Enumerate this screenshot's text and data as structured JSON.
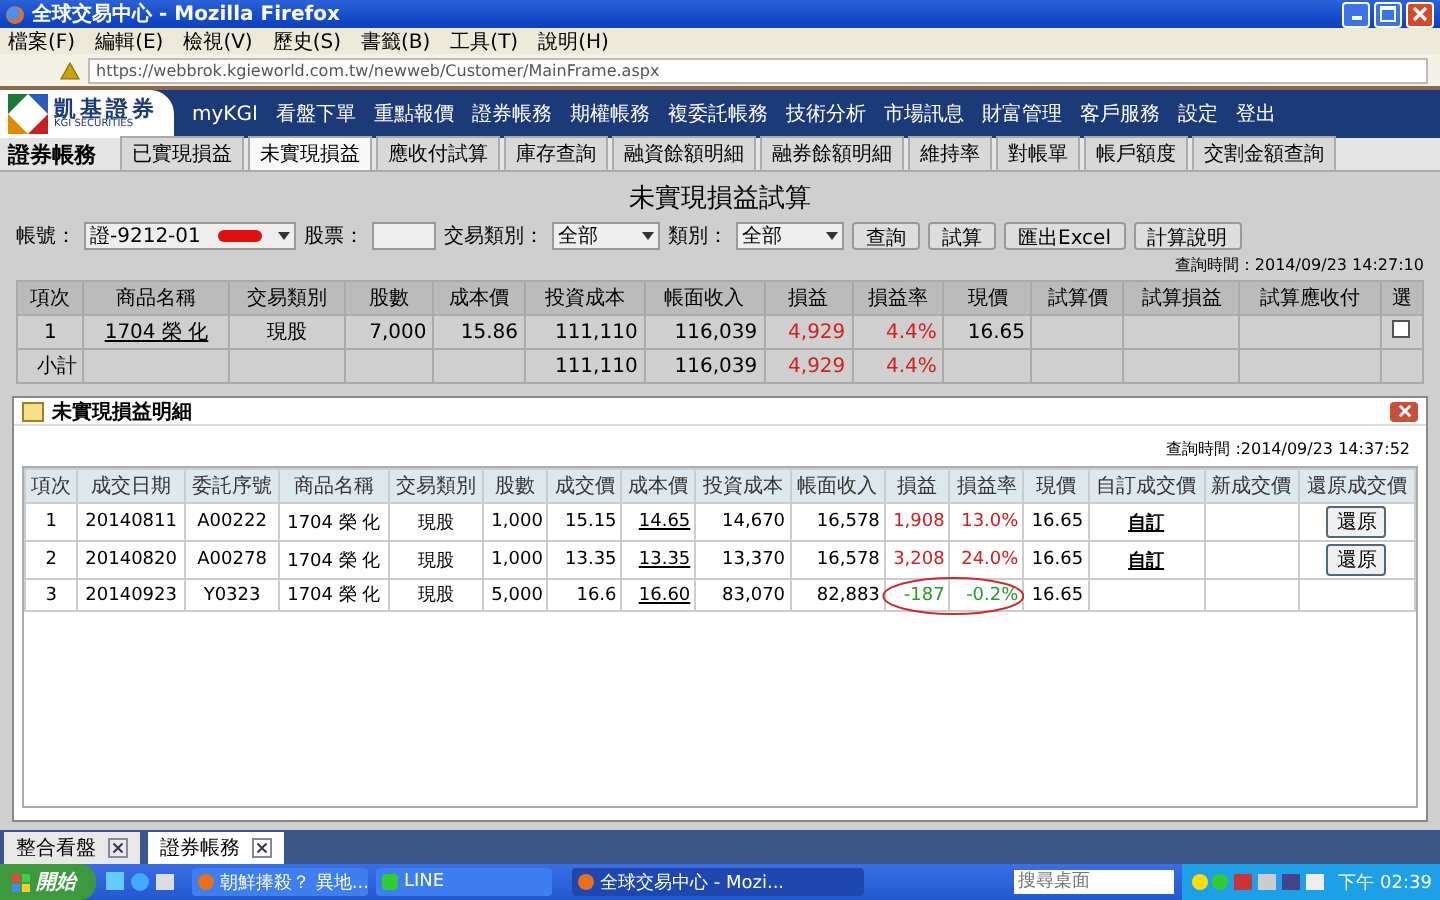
{
  "window": {
    "title": "全球交易中心 - Mozilla Firefox"
  },
  "menu": [
    "檔案(F)",
    "編輯(E)",
    "檢視(V)",
    "歷史(S)",
    "書籤(B)",
    "工具(T)",
    "說明(H)"
  ],
  "address_bar": {
    "url": "https://webbrok.kgieworld.com.tw/newweb/Customer/MainFrame.aspx"
  },
  "brand": {
    "name": "凱基證券",
    "sub": "KGI SECURITIES"
  },
  "nav": [
    "myKGI",
    "看盤下單",
    "重點報價",
    "證券帳務",
    "期權帳務",
    "複委託帳務",
    "技術分析",
    "市場訊息",
    "財富管理",
    "客戶服務",
    "設定",
    "登出"
  ],
  "section_title": "證券帳務",
  "tabs": [
    {
      "label": "已實現損益",
      "selected": false
    },
    {
      "label": "未實現損益",
      "selected": true
    },
    {
      "label": "應收付試算",
      "selected": false
    },
    {
      "label": "庫存查詢",
      "selected": false
    },
    {
      "label": "融資餘額明細",
      "selected": false
    },
    {
      "label": "融券餘額明細",
      "selected": false
    },
    {
      "label": "維持率",
      "selected": false
    },
    {
      "label": "對帳單",
      "selected": false
    },
    {
      "label": "帳戶額度",
      "selected": false
    },
    {
      "label": "交割金額查詢",
      "selected": false
    }
  ],
  "page_title": "未實現損益試算",
  "filters": {
    "account_label": "帳號：",
    "account_value": "證-9212-01",
    "stock_label": "股票：",
    "trade_type_label": "交易類別：",
    "trade_type_value": "全部",
    "category_label": "類別：",
    "category_value": "全部"
  },
  "buttons": [
    "查詢",
    "試算",
    "匯出Excel",
    "計算說明"
  ],
  "query_time": "查詢時間：2014/09/23 14:27:10",
  "table": {
    "columns": [
      "項次",
      "商品名稱",
      "交易類別",
      "股數",
      "成本價",
      "投資成本",
      "帳面收入",
      "損益",
      "損益率",
      "現價",
      "試算價",
      "試算損益",
      "試算應收付",
      "選"
    ],
    "rows": [
      {
        "no": "1",
        "product": "1704 榮 化",
        "trade_type": "現股",
        "shares": "7,000",
        "cost_price": "15.86",
        "cost": "111,110",
        "income": "116,039",
        "pl": "4,929",
        "pl_rate": "4.4%",
        "current": "16.65",
        "checked": false,
        "color": "#d02020"
      }
    ],
    "subtotal": {
      "label": "小計",
      "cost": "111,110",
      "income": "116,039",
      "pl": "4,929",
      "pl_rate": "4.4%",
      "color": "#d02020"
    }
  },
  "dialog": {
    "title": "未實現損益明細",
    "query_time": "查詢時間 :2014/09/23 14:37:52",
    "columns": [
      "項次",
      "成交日期",
      "委託序號",
      "商品名稱",
      "交易類別",
      "股數",
      "成交價",
      "成本價",
      "投資成本",
      "帳面收入",
      "損益",
      "損益率",
      "現價",
      "自訂成交價",
      "新成交價",
      "還原成交價"
    ],
    "rows": [
      {
        "no": "1",
        "date": "20140811",
        "order_no": "A00222",
        "product": "1704 榮 化",
        "trade_type": "現股",
        "shares": "1,000",
        "price": "15.15",
        "cost_price": "14.65",
        "cost": "14,670",
        "income": "16,578",
        "pl": "1,908",
        "pl_rate": "13.0%",
        "current": "16.65",
        "custom": "自訂",
        "restore": "還原",
        "color": "#d02020",
        "circled": false
      },
      {
        "no": "2",
        "date": "20140820",
        "order_no": "A00278",
        "product": "1704 榮 化",
        "trade_type": "現股",
        "shares": "1,000",
        "price": "13.35",
        "cost_price": "13.35",
        "cost": "13,370",
        "income": "16,578",
        "pl": "3,208",
        "pl_rate": "24.0%",
        "current": "16.65",
        "custom": "自訂",
        "restore": "還原",
        "color": "#d02020",
        "circled": false
      },
      {
        "no": "3",
        "date": "20140923",
        "order_no": "Y0323",
        "product": "1704 榮 化",
        "trade_type": "現股",
        "shares": "5,000",
        "price": "16.6",
        "cost_price": "16.60",
        "cost": "83,070",
        "income": "82,883",
        "pl": "-187",
        "pl_rate": "-0.2%",
        "current": "16.65",
        "color": "#2a9a2a",
        "circled": true
      }
    ]
  },
  "browser_tabs": [
    {
      "label": "整合看盤",
      "selected": false
    },
    {
      "label": "證券帳務",
      "selected": true
    }
  ],
  "taskbar": {
    "start": "開始",
    "tasks": [
      {
        "label": "朝鮮捧殺？ 異地...",
        "selected": false,
        "kind": "firefox"
      },
      {
        "label": "LINE",
        "selected": false,
        "kind": "line"
      },
      {
        "label": "全球交易中心 - Mozi...",
        "selected": true,
        "kind": "firefox"
      }
    ],
    "search_placeholder": "搜尋桌面",
    "clock": "下午 02:39"
  }
}
